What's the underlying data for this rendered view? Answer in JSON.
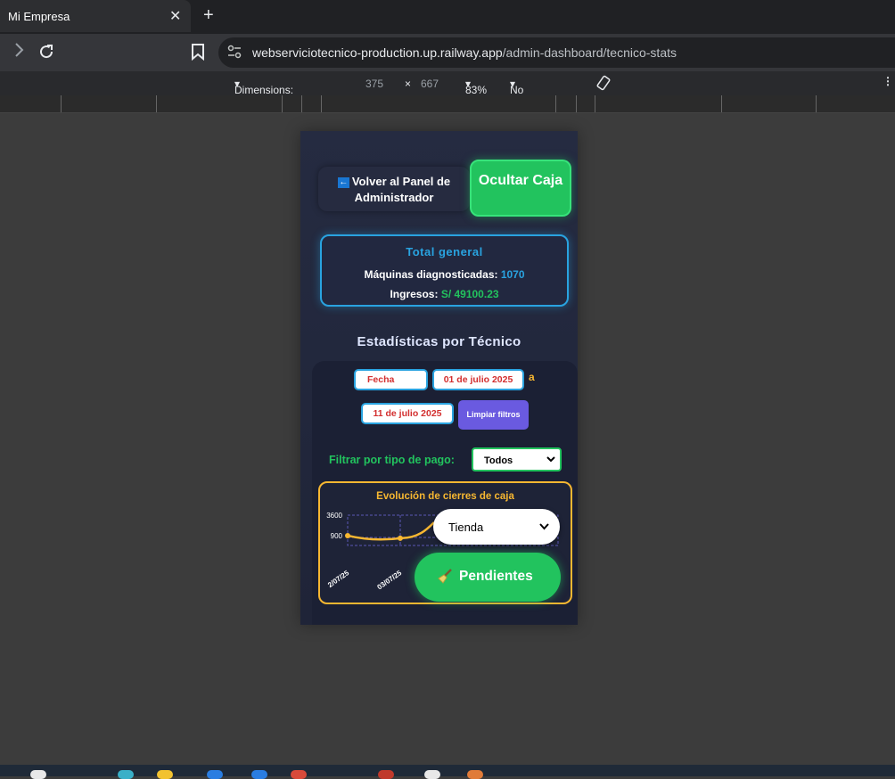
{
  "browser": {
    "tab_title": "Mi Empresa",
    "tab_close": "✕",
    "new_tab": "+",
    "url_host": "webserviciotecnico-production.up.railway.app",
    "url_path": "/admin-dashboard/tecnico-stats",
    "devtools": {
      "dimensions_label": "Dimensions: iPhone SE",
      "width": "375",
      "times": "×",
      "height": "667",
      "zoom": "83%",
      "throttling": "No throttling"
    }
  },
  "app": {
    "back_icon": "←",
    "back_label": "Volver al Panel de Administrador",
    "hide_label": "Ocultar Caja",
    "total": {
      "title": "Total general",
      "machines_label": "Máquinas diagnosticadas:",
      "machines_value": "1070",
      "income_label": "Ingresos:",
      "income_value": "S/ 49100.23"
    },
    "stats_title": "Estadísticas por Técnico",
    "filters": {
      "date_placeholder": "Fecha",
      "from_date": "01 de julio 2025",
      "separator": "a",
      "to_date": "11 de julio 2025",
      "clear_label": "Limpiar filtros",
      "payment_label": "Filtrar por tipo de pago:",
      "payment_value": "Todos"
    },
    "chart_data": {
      "type": "line",
      "title": "Evolución de cierres de caja",
      "x": [
        "2/07/25",
        "03/07/25"
      ],
      "y": [
        900,
        560
      ],
      "yticks": [
        3600,
        900
      ],
      "color": "#f7b731",
      "grid": true
    },
    "store_select_value": "Tienda",
    "pending_label": "Pendientes"
  }
}
